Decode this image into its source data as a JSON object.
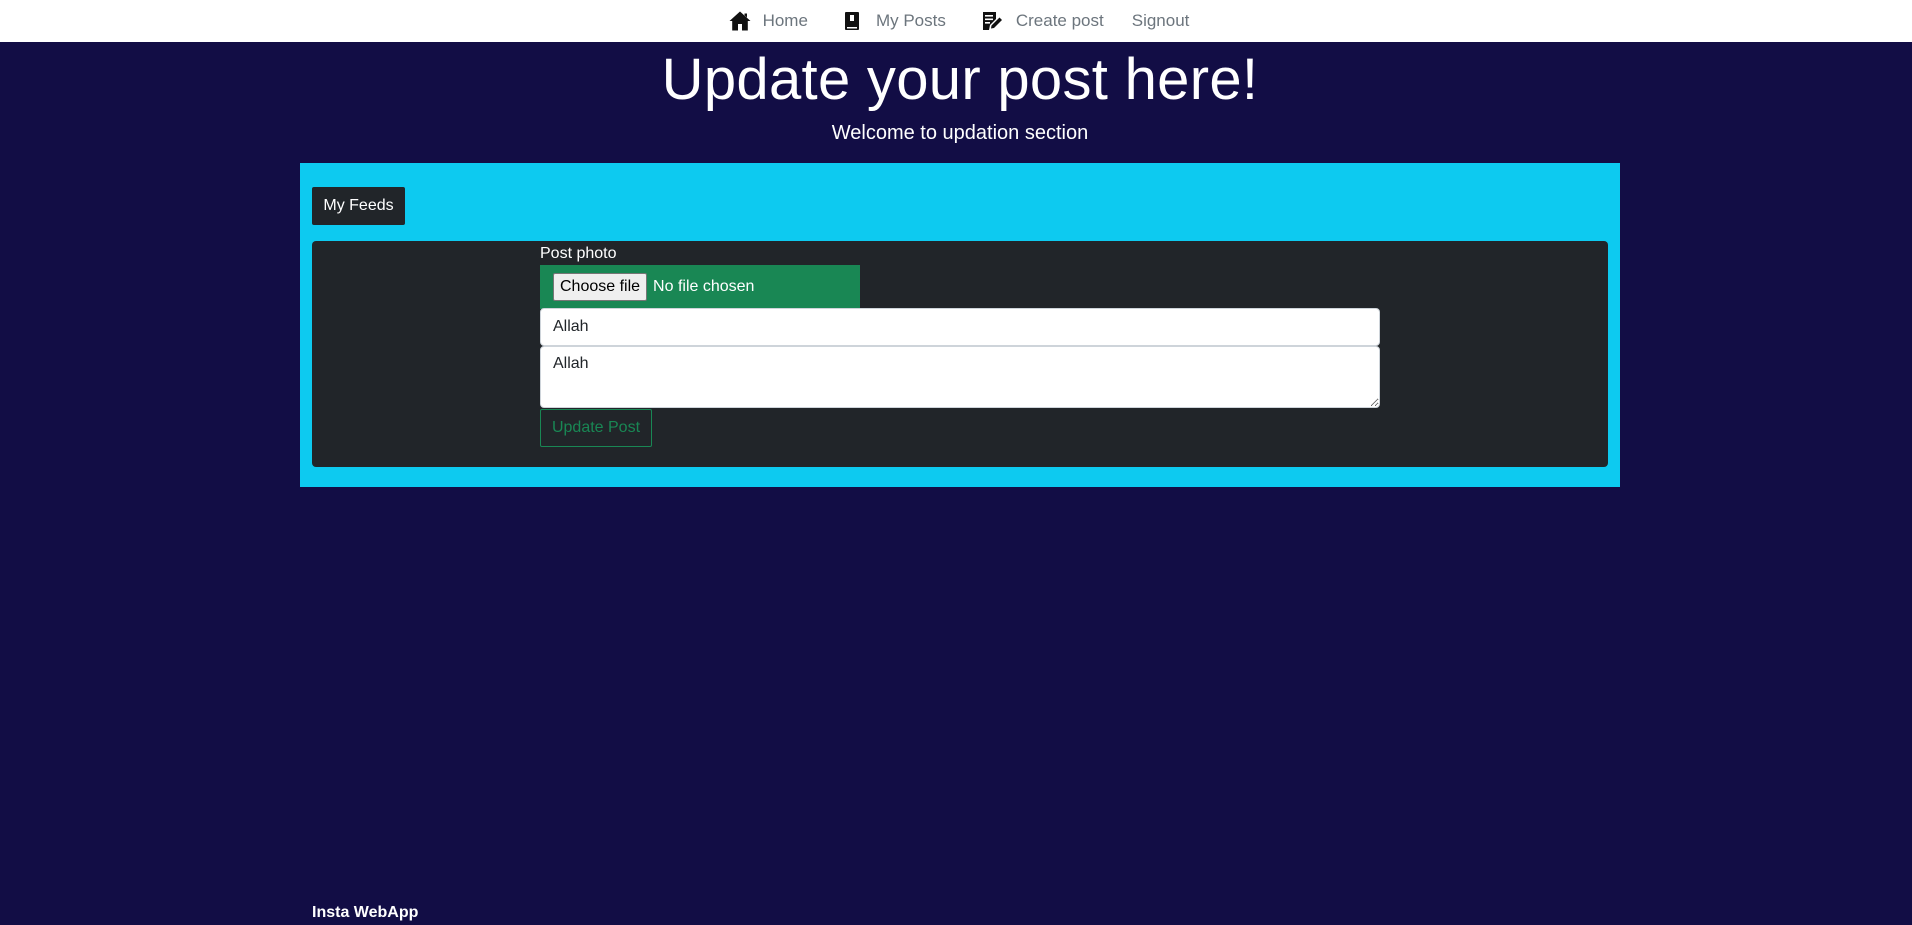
{
  "nav": {
    "items": [
      {
        "label": "Home",
        "icon": "home-icon"
      },
      {
        "label": "My Posts",
        "icon": "book-icon"
      },
      {
        "label": "Create post",
        "icon": "edit-note-icon"
      },
      {
        "label": "Signout"
      }
    ]
  },
  "hero": {
    "title": "Update your post here!",
    "subtitle": "Welcome to updation section"
  },
  "panel": {
    "feeds_button": "My Feeds",
    "photo_label": "Post photo",
    "choose_file": "Choose file",
    "no_file": "No file chosen",
    "title_value": "Allah",
    "description_value": "Allah",
    "update_button": "Update Post"
  },
  "footer": {
    "brand": "Insta WebApp"
  },
  "colors": {
    "background": "#120d45",
    "panel": "#0dcaf0",
    "card": "#212529",
    "success": "#198754"
  }
}
